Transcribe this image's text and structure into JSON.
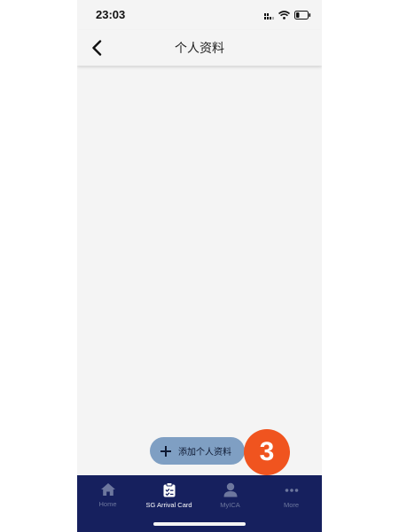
{
  "status_bar": {
    "time": "23:03"
  },
  "header": {
    "title": "个人资料",
    "back_icon": "chevron-left-icon"
  },
  "add_button": {
    "label": "添加个人资料",
    "icon": "plus-icon"
  },
  "step_badge": {
    "number": "3",
    "color": "#f0541f"
  },
  "tab_bar": {
    "background": "#16205e",
    "tabs": [
      {
        "label": "Home",
        "icon": "home-icon",
        "active": false
      },
      {
        "label": "SG Arrival Card",
        "icon": "clipboard-icon",
        "active": true
      },
      {
        "label": "MyICA",
        "icon": "user-icon",
        "active": false
      },
      {
        "label": "More",
        "icon": "more-dots-icon",
        "active": false
      }
    ]
  }
}
